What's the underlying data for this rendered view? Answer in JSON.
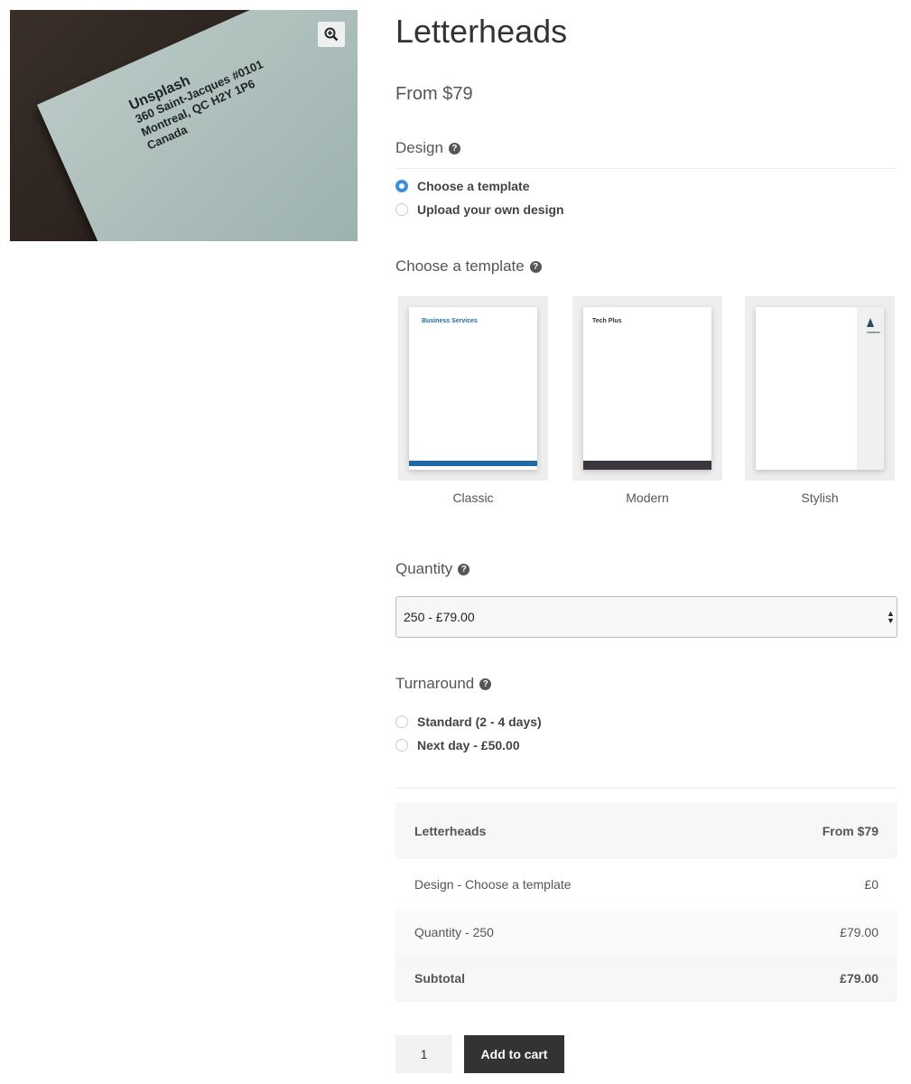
{
  "product": {
    "title": "Letterheads",
    "price": "From $79",
    "image_text": [
      "Unsplash",
      "360 Saint-Jacques #0101",
      "Montreal, QC  H2Y 1P6",
      "Canada"
    ]
  },
  "design": {
    "label": "Design",
    "options": [
      {
        "label": "Choose a template",
        "selected": true
      },
      {
        "label": "Upload your own design",
        "selected": false
      }
    ]
  },
  "templates": {
    "label": "Choose a template",
    "items": [
      {
        "name": "Classic",
        "heading": "Business Services",
        "accent": "#1f6aa5"
      },
      {
        "name": "Modern",
        "heading": "Tech Plus",
        "accent": "#3b3540"
      },
      {
        "name": "Stylish",
        "heading": "COMPANY",
        "accent": "#2b4b5a"
      }
    ]
  },
  "quantity": {
    "label": "Quantity",
    "selected": "250 - £79.00"
  },
  "turnaround": {
    "label": "Turnaround",
    "options": [
      {
        "label": "Standard (2 - 4 days)",
        "selected": false
      },
      {
        "label": "Next day - £50.00",
        "selected": false
      }
    ]
  },
  "summary": {
    "rows": [
      {
        "label": "Letterheads",
        "value": "From $79"
      },
      {
        "label": "Design - Choose a template",
        "value": "£0"
      },
      {
        "label": "Quantity - 250",
        "value": "£79.00"
      },
      {
        "label": "Subtotal",
        "value": "£79.00"
      }
    ]
  },
  "cart": {
    "qty": "1",
    "button": "Add to cart"
  },
  "help_icon": "?"
}
